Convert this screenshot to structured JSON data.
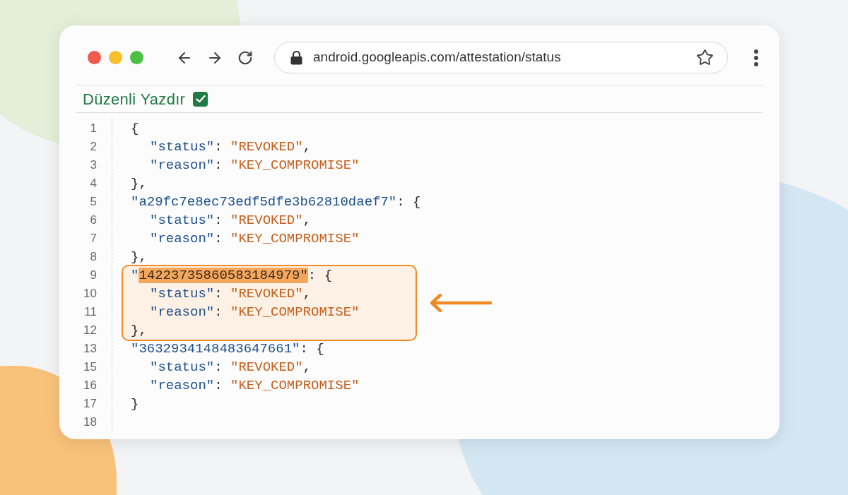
{
  "browser": {
    "url": "android.googleapis.com/attestation/status"
  },
  "pretty_print": {
    "label": "Düzenli Yazdır",
    "checked": true
  },
  "code": [
    {
      "kind": "line",
      "number": "1",
      "tokens": [
        {
          "kind": "punct",
          "text": "{"
        }
      ],
      "children": [
        {
          "kind": "line",
          "number": "2",
          "tokens": [
            {
              "kind": "key",
              "text": "\"status\""
            },
            {
              "kind": "punct",
              "text": ": "
            },
            {
              "kind": "string",
              "text": "\"REVOKED\""
            },
            {
              "kind": "punct",
              "text": ","
            }
          ]
        },
        {
          "kind": "line",
          "number": "3",
          "tokens": [
            {
              "kind": "key",
              "text": "\"reason\""
            },
            {
              "kind": "punct",
              "text": ": "
            },
            {
              "kind": "string",
              "text": "\"KEY_COMPROMISE\""
            }
          ]
        }
      ]
    },
    {
      "kind": "line",
      "number": "4",
      "tokens": [
        {
          "kind": "punct",
          "text": "},"
        }
      ]
    },
    {
      "kind": "line",
      "number": "5",
      "tokens": [
        {
          "kind": "key",
          "text": "\"a29fc7e8ec73edf5dfe3b62810daef7\""
        },
        {
          "kind": "punct",
          "text": ": {"
        }
      ],
      "children": [
        {
          "kind": "line",
          "number": "6",
          "tokens": [
            {
              "kind": "key",
              "text": "\"status\""
            },
            {
              "kind": "punct",
              "text": ": "
            },
            {
              "kind": "string",
              "text": "\"REVOKED\""
            },
            {
              "kind": "punct",
              "text": ","
            }
          ]
        },
        {
          "kind": "line",
          "number": "7",
          "tokens": [
            {
              "kind": "key",
              "text": "\"reason\""
            },
            {
              "kind": "punct",
              "text": ": "
            },
            {
              "kind": "string",
              "text": "\"KEY_COMPROMISE\""
            }
          ]
        }
      ]
    },
    {
      "kind": "line",
      "number": "8",
      "tokens": [
        {
          "kind": "punct",
          "text": "},"
        }
      ]
    },
    {
      "kind": "highlight",
      "lines": [
        {
          "kind": "line",
          "number": "9",
          "tokens": [
            {
              "kind": "key",
              "text": "\""
            },
            {
              "kind": "mark",
              "text": "14223735860583184979\""
            },
            {
              "kind": "punct",
              "text": ": {"
            }
          ],
          "children": [
            {
              "kind": "line",
              "number": "10",
              "tokens": [
                {
                  "kind": "key",
                  "text": "\"status\""
                },
                {
                  "kind": "punct",
                  "text": ": "
                },
                {
                  "kind": "string",
                  "text": "\"REVOKED\""
                },
                {
                  "kind": "punct",
                  "text": ","
                }
              ]
            },
            {
              "kind": "line",
              "number": "11",
              "tokens": [
                {
                  "kind": "key",
                  "text": "\"reason\""
                },
                {
                  "kind": "punct",
                  "text": ": "
                },
                {
                  "kind": "string",
                  "text": "\"KEY_COMPROMISE\""
                }
              ]
            }
          ]
        },
        {
          "kind": "line",
          "number": "12",
          "tokens": [
            {
              "kind": "punct",
              "text": "},"
            }
          ]
        }
      ]
    },
    {
      "kind": "line",
      "number": "13",
      "tokens": [
        {
          "kind": "key",
          "text": "\"3632934148483647661\""
        },
        {
          "kind": "punct",
          "text": ": {"
        }
      ],
      "children": [
        {
          "kind": "line",
          "number": "15",
          "tokens": [
            {
              "kind": "key",
              "text": "\"status\""
            },
            {
              "kind": "punct",
              "text": ": "
            },
            {
              "kind": "string",
              "text": "\"REVOKED\""
            },
            {
              "kind": "punct",
              "text": ","
            }
          ]
        },
        {
          "kind": "line",
          "number": "16",
          "tokens": [
            {
              "kind": "key",
              "text": "\"reason\""
            },
            {
              "kind": "punct",
              "text": ": "
            },
            {
              "kind": "string",
              "text": "\"KEY_COMPROMISE\""
            }
          ]
        }
      ]
    },
    {
      "kind": "line",
      "number": "17",
      "tokens": [
        {
          "kind": "punct",
          "text": "}"
        }
      ]
    },
    {
      "kind": "line",
      "number": "18"
    }
  ]
}
